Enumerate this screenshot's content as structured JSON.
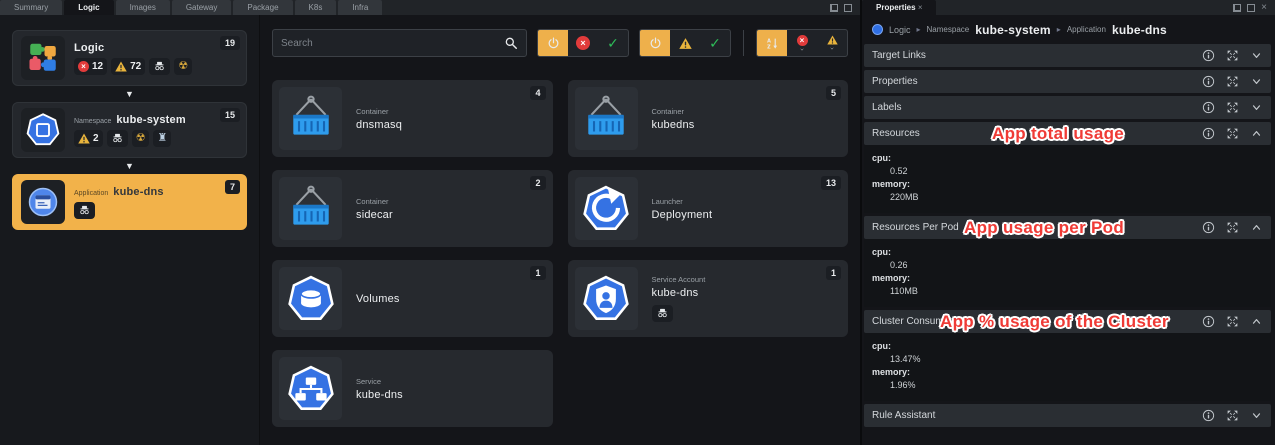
{
  "colors": {
    "accent_orange": "#eeb04b",
    "error_red": "#e23b3b",
    "warning_yellow": "#e9b43c",
    "ok_green": "#2ebd59",
    "kube_blue": "#3572e3",
    "annotation_red": "#ef3b36",
    "selected_node": "#f2b24a"
  },
  "window_tabs": {
    "items": [
      "Summary",
      "Logic",
      "Images",
      "Gateway",
      "Package",
      "K8s",
      "Infra"
    ],
    "active": "Logic"
  },
  "sidebar": {
    "nodes": [
      {
        "type": "",
        "name": "Logic",
        "count": "19",
        "error_count": "12",
        "warning_count": "72"
      },
      {
        "type": "Namespace",
        "name": "kube-system",
        "count": "15",
        "warning_count": "2"
      },
      {
        "type": "Application",
        "name": "kube-dns",
        "count": "7"
      }
    ]
  },
  "toolbar": {
    "search_placeholder": "Search"
  },
  "cards": [
    {
      "type": "Container",
      "name": "dnsmasq",
      "count": "4"
    },
    {
      "type": "Container",
      "name": "kubedns",
      "count": "5"
    },
    {
      "type": "Container",
      "name": "sidecar",
      "count": "2"
    },
    {
      "type": "Launcher",
      "name": "Deployment",
      "count": "13"
    },
    {
      "type": "",
      "name": "Volumes",
      "count": "1"
    },
    {
      "type": "Service Account",
      "name": "kube-dns",
      "count": "1"
    },
    {
      "type": "Service",
      "name": "kube-dns",
      "count": ""
    }
  ],
  "properties_panel": {
    "tab_title": "Properties",
    "breadcrumb": {
      "root": "Logic",
      "namespace_label": "Namespace",
      "namespace": "kube-system",
      "application_label": "Application",
      "application": "kube-dns"
    },
    "sections": [
      {
        "title": "Target Links",
        "expanded": false
      },
      {
        "title": "Properties",
        "expanded": false
      },
      {
        "title": "Labels",
        "expanded": false
      },
      {
        "title": "Resources",
        "expanded": true,
        "annotation": "App total usage",
        "rows": [
          {
            "key": "cpu:",
            "value": "0.52"
          },
          {
            "key": "memory:",
            "value": "220MB"
          }
        ]
      },
      {
        "title": "Resources Per Pod",
        "expanded": true,
        "annotation": "App usage per Pod",
        "rows": [
          {
            "key": "cpu:",
            "value": "0.26"
          },
          {
            "key": "memory:",
            "value": "110MB"
          }
        ]
      },
      {
        "title": "Cluster Consumption",
        "expanded": true,
        "annotation": "App % usage of the Cluster",
        "rows": [
          {
            "key": "cpu:",
            "value": "13.47%"
          },
          {
            "key": "memory:",
            "value": "1.96%"
          }
        ]
      },
      {
        "title": "Rule Assistant",
        "expanded": false
      }
    ]
  }
}
